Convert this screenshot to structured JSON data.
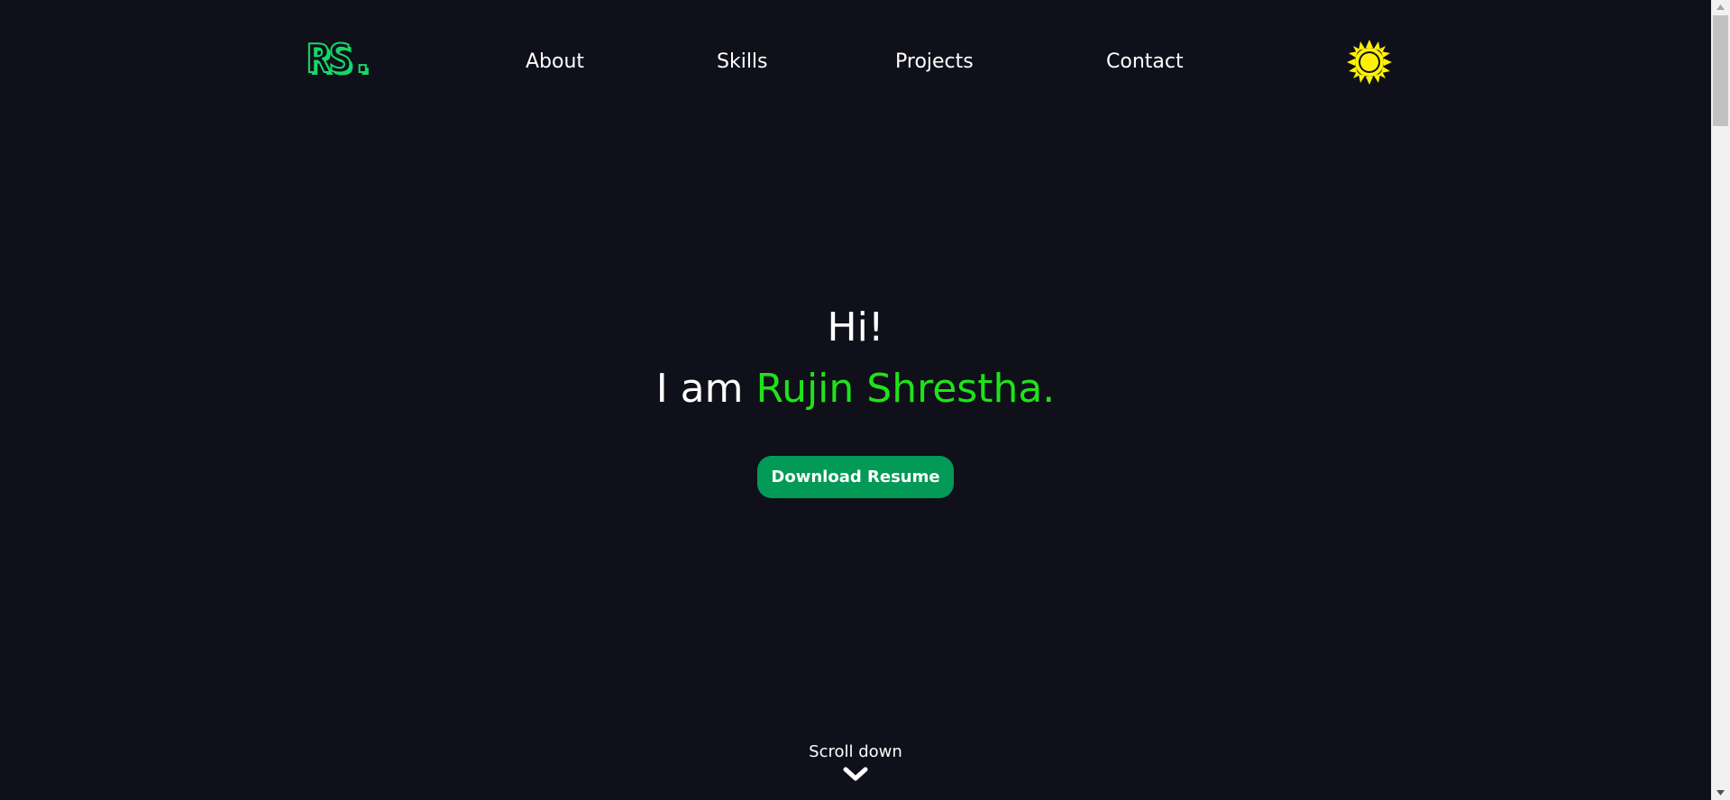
{
  "logo": {
    "text": "RS."
  },
  "nav": {
    "links": [
      {
        "label": "About"
      },
      {
        "label": "Skills"
      },
      {
        "label": "Projects"
      },
      {
        "label": "Contact"
      }
    ],
    "theme_toggle_icon": "sun-icon"
  },
  "hero": {
    "greeting": "Hi!",
    "intro_prefix": "I am ",
    "name": "Rujin Shrestha.",
    "resume_button": "Download Resume",
    "scroll_label": "Scroll down",
    "scroll_icon": "chevron-down-icon"
  },
  "colors": {
    "background": "#0f1019",
    "accent_green": "#1fe31a",
    "logo_green": "#14d96a",
    "button_green": "#039a57",
    "sun_yellow": "#fff200",
    "text": "#ffffff"
  }
}
